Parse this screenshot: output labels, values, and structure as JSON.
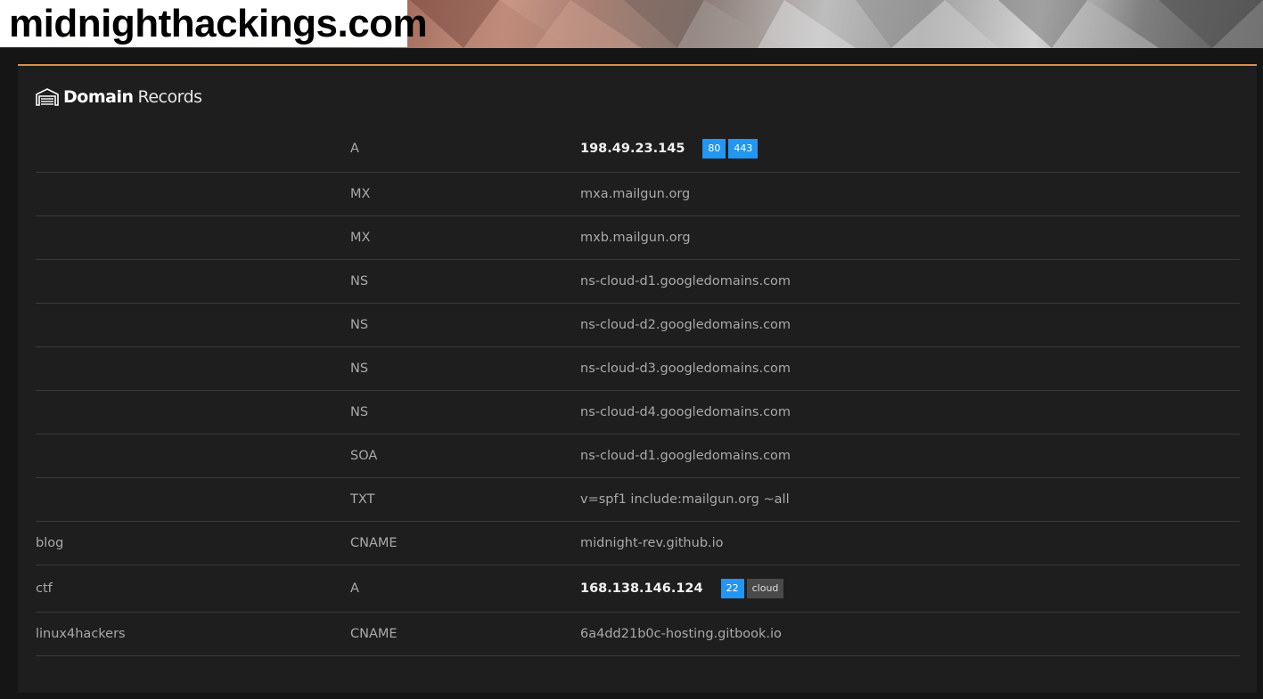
{
  "site": {
    "title": "midnighthackings.com"
  },
  "panel": {
    "title_bold": "Domain",
    "title_light": "Records"
  },
  "colors": {
    "accent": "#d9904a",
    "badge_blue": "#2196f3",
    "badge_gray": "#4a4a4a"
  },
  "records": [
    {
      "host": "",
      "type": "A",
      "value": "198.49.23.145",
      "strong": true,
      "badges": [
        {
          "text": "80",
          "style": "blue"
        },
        {
          "text": "443",
          "style": "blue"
        }
      ]
    },
    {
      "host": "",
      "type": "MX",
      "value": "mxa.mailgun.org"
    },
    {
      "host": "",
      "type": "MX",
      "value": "mxb.mailgun.org"
    },
    {
      "host": "",
      "type": "NS",
      "value": "ns-cloud-d1.googledomains.com"
    },
    {
      "host": "",
      "type": "NS",
      "value": "ns-cloud-d2.googledomains.com"
    },
    {
      "host": "",
      "type": "NS",
      "value": "ns-cloud-d3.googledomains.com"
    },
    {
      "host": "",
      "type": "NS",
      "value": "ns-cloud-d4.googledomains.com"
    },
    {
      "host": "",
      "type": "SOA",
      "value": "ns-cloud-d1.googledomains.com"
    },
    {
      "host": "",
      "type": "TXT",
      "value": "v=spf1 include:mailgun.org ~all"
    },
    {
      "host": "blog",
      "type": "CNAME",
      "value": "midnight-rev.github.io"
    },
    {
      "host": "ctf",
      "type": "A",
      "value": "168.138.146.124",
      "strong": true,
      "badges": [
        {
          "text": "22",
          "style": "blue"
        },
        {
          "text": "cloud",
          "style": "gray"
        }
      ]
    },
    {
      "host": "linux4hackers",
      "type": "CNAME",
      "value": "6a4dd21b0c-hosting.gitbook.io"
    }
  ]
}
